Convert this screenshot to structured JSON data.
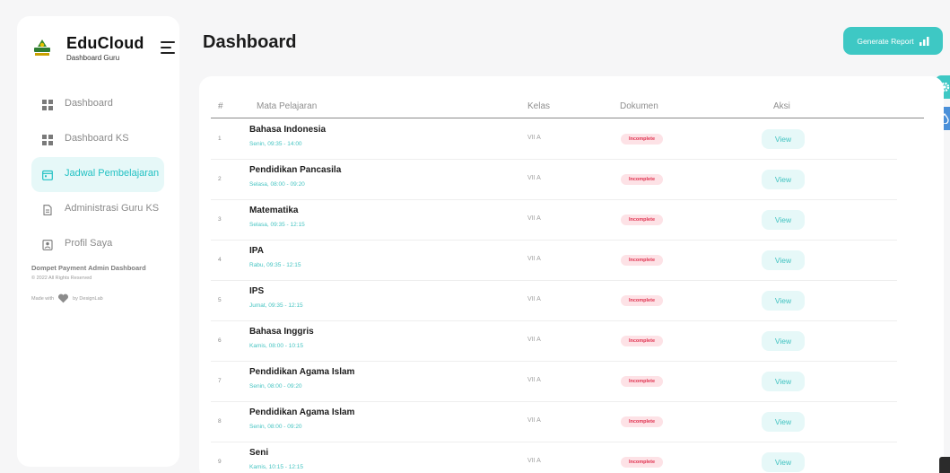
{
  "brand": {
    "title": "EduCloud",
    "subtitle": "Dashboard Guru"
  },
  "sidebar": {
    "items": [
      {
        "label": "Dashboard",
        "icon": "grid-icon",
        "active": false
      },
      {
        "label": "Dashboard KS",
        "icon": "grid-icon",
        "active": false
      },
      {
        "label": "Jadwal Pembelajaran",
        "icon": "calendar-icon",
        "active": true
      },
      {
        "label": "Administrasi Guru KS",
        "icon": "document-icon",
        "active": false
      },
      {
        "label": "Profil Saya",
        "icon": "profile-icon",
        "active": false
      }
    ],
    "footer_title": "Dompet Payment Admin Dashboard",
    "footer_copy": "© 2022 All Rights Reserved",
    "made_with": "Made with",
    "made_by": "by DesignLab"
  },
  "header": {
    "title": "Dashboard",
    "generate_label": "Generate Report"
  },
  "colors": {
    "accent": "#3ec8c4",
    "active_bg": "#e6f8f8",
    "badge_bg": "#fde2e6",
    "badge_text": "#e0314f"
  },
  "table": {
    "headers": {
      "num": "#",
      "subject": "Mata Pelajaran",
      "class": "Kelas",
      "doc": "Dokumen",
      "action": "Aksi"
    },
    "rows": [
      {
        "num": "1",
        "subject": "Bahasa Indonesia",
        "time": "Senin, 09:35 - 14:00",
        "class": "VII A",
        "status": "Incomplete",
        "action": "View"
      },
      {
        "num": "2",
        "subject": "Pendidikan Pancasila",
        "time": "Selasa, 08:00 - 09:20",
        "class": "VII A",
        "status": "Incomplete",
        "action": "View"
      },
      {
        "num": "3",
        "subject": "Matematika",
        "time": "Selasa, 09:35 - 12:15",
        "class": "VII A",
        "status": "Incomplete",
        "action": "View"
      },
      {
        "num": "4",
        "subject": "IPA",
        "time": "Rabu, 09:35 - 12:15",
        "class": "VII A",
        "status": "Incomplete",
        "action": "View"
      },
      {
        "num": "5",
        "subject": "IPS",
        "time": "Jumat, 09:35 - 12:15",
        "class": "VII A",
        "status": "Incomplete",
        "action": "View"
      },
      {
        "num": "6",
        "subject": "Bahasa Inggris",
        "time": "Kamis, 08:00 - 10:15",
        "class": "VII A",
        "status": "Incomplete",
        "action": "View"
      },
      {
        "num": "7",
        "subject": "Pendidikan Agama Islam",
        "time": "Senin, 08:00 - 09:20",
        "class": "VII A",
        "status": "Incomplete",
        "action": "View"
      },
      {
        "num": "8",
        "subject": "Pendidikan Agama Islam",
        "time": "Senin, 08:00 - 09:20",
        "class": "VII A",
        "status": "Incomplete",
        "action": "View"
      },
      {
        "num": "9",
        "subject": "Seni",
        "time": "Kamis, 10:15 - 12:15",
        "class": "VII A",
        "status": "Incomplete",
        "action": "View"
      }
    ]
  }
}
